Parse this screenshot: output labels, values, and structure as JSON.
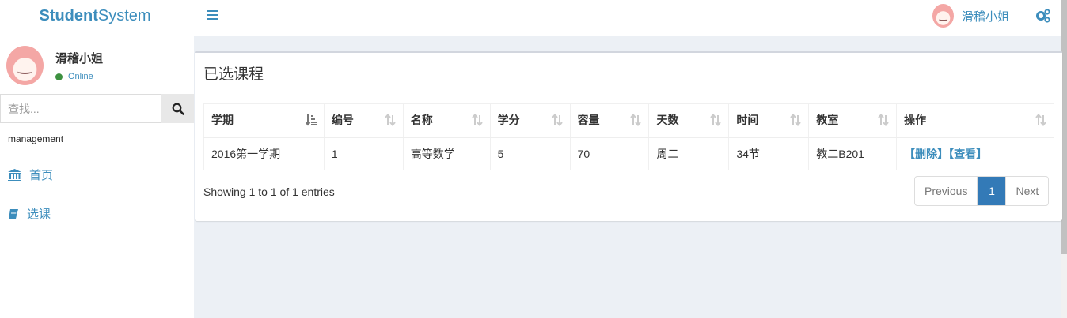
{
  "header": {
    "logo_bold": "Student",
    "logo_rest": "System",
    "user_name": "滑稽小姐"
  },
  "sidebar": {
    "user_name": "滑稽小姐",
    "status": "Online",
    "search_placeholder": "查找...",
    "section_header": "management",
    "items": [
      {
        "label": "首页",
        "icon": "bank-icon"
      },
      {
        "label": "选课",
        "icon": "book-icon"
      }
    ]
  },
  "main": {
    "title": "已选课程",
    "columns": [
      "学期",
      "编号",
      "名称",
      "学分",
      "容量",
      "天数",
      "时间",
      "教室",
      "操作"
    ],
    "rows": [
      {
        "term": "2016第一学期",
        "id": "1",
        "name": "高等数学",
        "credit": "5",
        "capacity": "70",
        "day": "周二",
        "time": "34节",
        "room": "教二B201",
        "delete": "【删除】",
        "view": "【查看】"
      }
    ],
    "info": "Showing 1 to 1 of 1 entries",
    "pagination": {
      "previous": "Previous",
      "current": "1",
      "next": "Next"
    }
  },
  "colors": {
    "accent": "#3c8dbc",
    "page_bg": "#ecf0f5",
    "active_page": "#337ab7",
    "online": "#3d9140"
  }
}
